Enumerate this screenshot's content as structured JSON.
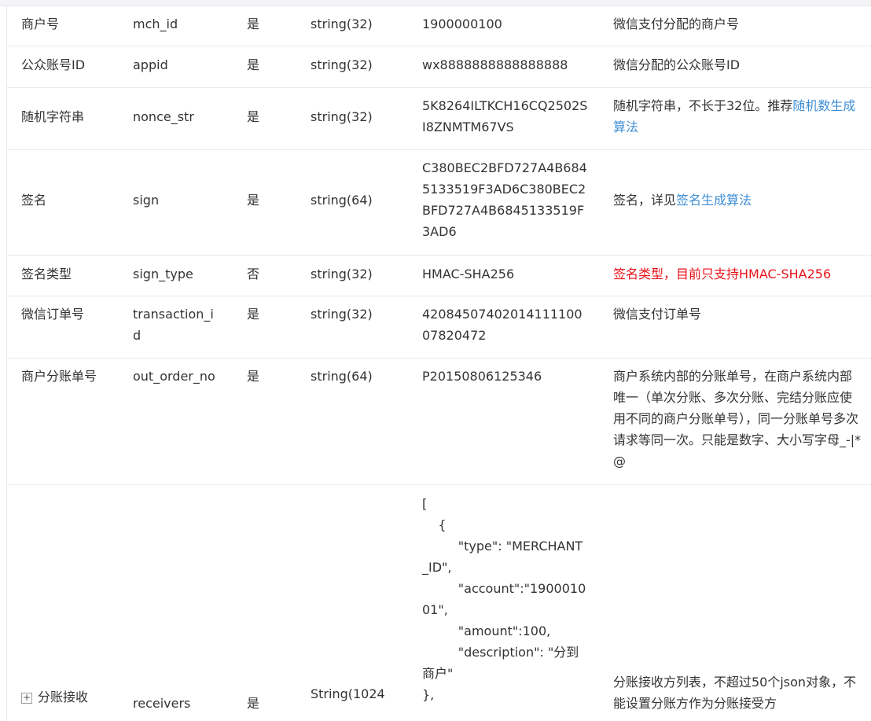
{
  "rows": [
    {
      "name": "商户号",
      "field": "mch_id",
      "required": "是",
      "type": "string(32)",
      "example": "1900000100",
      "desc": "微信支付分配的商户号"
    },
    {
      "name": "公众账号ID",
      "field": "appid",
      "required": "是",
      "type": "string(32)",
      "example": "wx8888888888888888",
      "desc": "微信分配的公众账号ID"
    },
    {
      "name": "随机字符串",
      "field": "nonce_str",
      "required": "是",
      "type": "string(32)",
      "example": "5K8264ILTKCH16CQ2502SI8ZNMTM67VS",
      "desc_text": "随机字符串，不长于32位。推荐",
      "desc_link": "随机数生成算法"
    },
    {
      "name": "签名",
      "field": "sign",
      "required": "是",
      "type": "string(64)",
      "example": "C380BEC2BFD727A4B6845133519F3AD6C380BEC2BFD727A4B6845133519F3AD6",
      "desc_text": "签名，详见",
      "desc_link": "签名生成算法"
    },
    {
      "name": "签名类型",
      "field": "sign_type",
      "required": "否",
      "type": "string(32)",
      "example": "HMAC-SHA256",
      "desc": "签名类型，目前只支持HMAC-SHA256"
    },
    {
      "name": "微信订单号",
      "field": "transaction_id",
      "required": "是",
      "type": "string(32)",
      "example": "4208450740201411110007820472",
      "desc": "微信支付订单号"
    },
    {
      "name": "商户分账单号",
      "field": "out_order_no",
      "required": "是",
      "type": "string(64)",
      "example": "P20150806125346",
      "desc": "商户系统内部的分账单号，在商户系统内部唯一（单次分账、多次分账、完结分账应使用不同的商户分账单号），同一分账单号多次请求等同一次。只能是数字、大小写字母_-|*@"
    },
    {
      "expand": "+",
      "name": "分账接收",
      "field": "receivers",
      "required": "是",
      "type": "String(1024",
      "example": "[\n    {\n         \"type\": \"MERCHANT_ID\",\n         \"account\":\"190001001\",\n         \"amount\":100,\n         \"description\": \"分到商户\"\n},",
      "desc": "分账接收方列表，不超过50个json对象，不能设置分账方作为分账接受方"
    }
  ]
}
